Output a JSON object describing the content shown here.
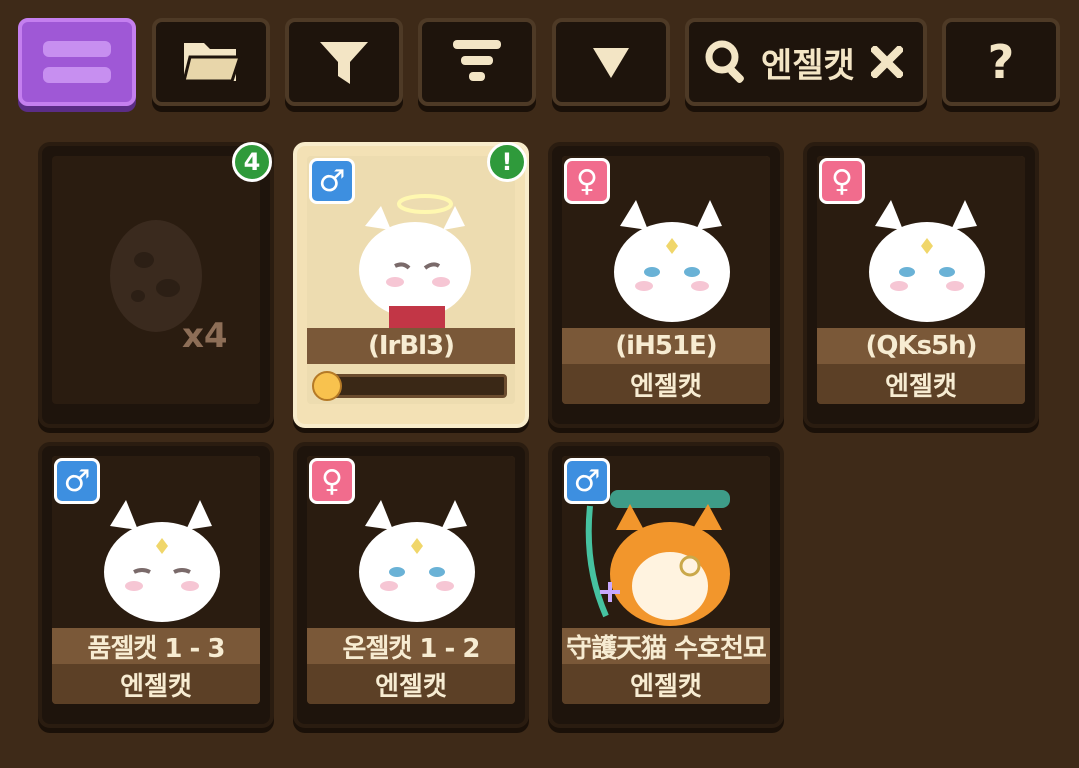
{
  "toolbar": {
    "search_value": "엔젤캣",
    "help_label": "?",
    "icons": [
      "menu-icon",
      "folder-icon",
      "filter-icon",
      "sort-icon",
      "dropdown-icon",
      "search-icon",
      "clear-icon"
    ]
  },
  "egg_slot": {
    "badge": "4",
    "count": "x4"
  },
  "cards": [
    {
      "gender": "male",
      "gender_symbol": "♂",
      "name": "(IrBl3)",
      "type": "",
      "badge": "!",
      "progress": 0.1,
      "selected": true
    },
    {
      "gender": "female",
      "gender_symbol": "♀",
      "name": "(iH51E)",
      "type": "엔젤캣"
    },
    {
      "gender": "female",
      "gender_symbol": "♀",
      "name": "(QKs5h)",
      "type": "엔젤캣"
    },
    {
      "gender": "male",
      "gender_symbol": "♂",
      "name": "품젤캣 1 - 3",
      "type": "엔젤캣"
    },
    {
      "gender": "female",
      "gender_symbol": "♀",
      "name": "온젤캣 1 - 2",
      "type": "엔젤캣"
    },
    {
      "gender": "male",
      "gender_symbol": "♂",
      "name": "守護天猫 수호천묘",
      "type": "엔젤캣"
    }
  ],
  "colors": {
    "background": "#3e2a18",
    "accent": "#9f58d6",
    "male": "#3d8fe0",
    "female": "#f16c8d",
    "badge": "#2f9a3b"
  }
}
